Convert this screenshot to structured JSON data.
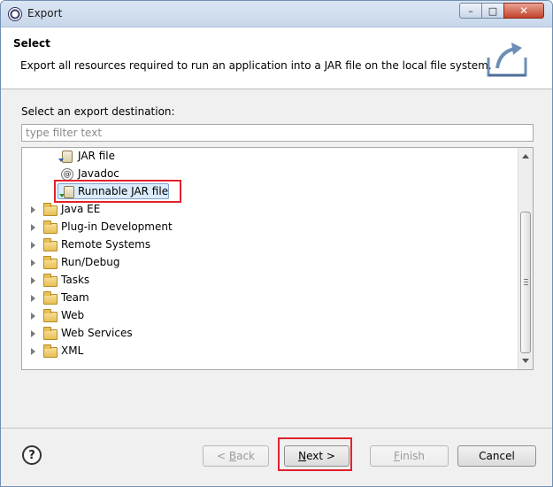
{
  "window": {
    "title": "Export",
    "minimize_glyph": "–",
    "maximize_glyph": "□",
    "close_glyph": "✕"
  },
  "banner": {
    "title": "Select",
    "description": "Export all resources required to run an application into a JAR file on the local file system.",
    "icon": "export-wizard-icon"
  },
  "destination": {
    "label": "Select an export destination:",
    "filter_placeholder": "type filter text",
    "filter_value": ""
  },
  "tree": {
    "items": [
      {
        "label": "JAR file",
        "icon": "jar-icon",
        "expandable": false,
        "selected": false
      },
      {
        "label": "Javadoc",
        "icon": "javadoc-icon",
        "expandable": false,
        "selected": false
      },
      {
        "label": "Runnable JAR file",
        "icon": "runnable-jar-icon",
        "expandable": false,
        "selected": true
      },
      {
        "label": "Java EE",
        "icon": "folder-icon",
        "expandable": true,
        "selected": false
      },
      {
        "label": "Plug-in Development",
        "icon": "folder-icon",
        "expandable": true,
        "selected": false
      },
      {
        "label": "Remote Systems",
        "icon": "folder-icon",
        "expandable": true,
        "selected": false
      },
      {
        "label": "Run/Debug",
        "icon": "folder-icon",
        "expandable": true,
        "selected": false
      },
      {
        "label": "Tasks",
        "icon": "folder-icon",
        "expandable": true,
        "selected": false
      },
      {
        "label": "Team",
        "icon": "folder-icon",
        "expandable": true,
        "selected": false
      },
      {
        "label": "Web",
        "icon": "folder-icon",
        "expandable": true,
        "selected": false
      },
      {
        "label": "Web Services",
        "icon": "folder-icon",
        "expandable": true,
        "selected": false
      },
      {
        "label": "XML",
        "icon": "folder-icon",
        "expandable": true,
        "selected": false
      }
    ]
  },
  "footer": {
    "help_glyph": "?",
    "back": {
      "mnemonic": "B",
      "rest": "ack",
      "prefix": "< ",
      "enabled": false
    },
    "next": {
      "mnemonic": "N",
      "rest": "ext",
      "suffix": " >",
      "enabled": true
    },
    "finish": {
      "mnemonic": "F",
      "rest": "inish",
      "enabled": false
    },
    "cancel": {
      "label": "Cancel",
      "enabled": true
    }
  },
  "colors": {
    "highlight_red": "#e0222d",
    "selection_bg": "#dcebfc",
    "selection_border": "#7da2ce"
  }
}
